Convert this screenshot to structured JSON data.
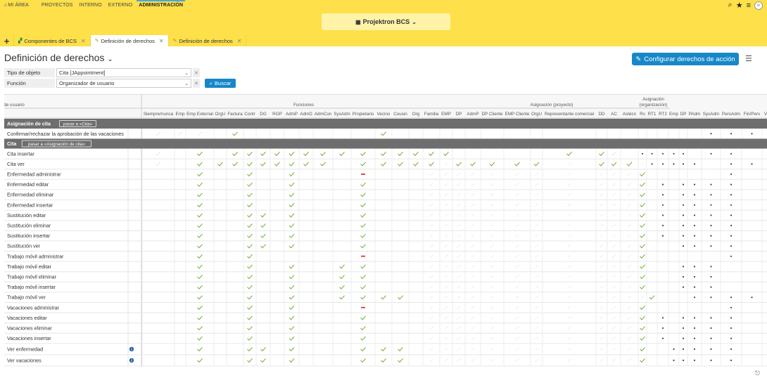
{
  "nav": {
    "items": [
      {
        "label": "MI ÁREA",
        "active": false
      },
      {
        "label": "PROYECTOS",
        "active": false
      },
      {
        "label": "INTERNO",
        "active": false
      },
      {
        "label": "EXTERNO",
        "active": false
      },
      {
        "label": "ADMINISTRACIÓN",
        "active": true
      }
    ]
  },
  "project": {
    "label": "Projektron BCS"
  },
  "tabs": [
    {
      "label": "Componentes de BCS",
      "active": false
    },
    {
      "label": "Definición de derechos",
      "active": true
    },
    {
      "label": "Definición de derechos",
      "active": false
    }
  ],
  "page": {
    "title": "Definición de derechos",
    "config_button": "Configurar derechos de acción"
  },
  "filters": {
    "tipo_label": "Tipo de objeto",
    "tipo_value": "Cita [JAppointment]",
    "funcion_label": "Función",
    "funcion_value": "Organizador de usuario",
    "search_button": "Buscar"
  },
  "colors": {
    "accent": "#1787c8",
    "topbar": "#fde04a",
    "check": "#7fb24b",
    "forbidden": "#d9363e",
    "section": "#6e6e6e"
  },
  "table": {
    "groups": [
      {
        "label": "Funciones",
        "start": 1,
        "end": 19
      },
      {
        "label": "Asignación (proyecto)",
        "start": 20,
        "end": 27
      },
      {
        "label": "Asignación (organización)",
        "start": 28,
        "end": 30
      },
      {
        "label": "Licencias de usuario",
        "start": 31,
        "end": 43
      }
    ],
    "columns": [
      "Siempre/nunca",
      "Emp",
      "Emp External",
      "OrgU",
      "Factura",
      "Contr",
      "DG",
      "RGP",
      "AdmP",
      "AdmD",
      "AdmCon",
      "SysAdm",
      "Propietario",
      "Vecino",
      "Cousin",
      "Org",
      "Familia",
      "EMP",
      "DP",
      "AdmP",
      "DP Cliente",
      "EMP Cliente",
      "OrgU",
      "Representante comercial",
      "DD",
      "AC",
      "Astécn",
      "Rs",
      "RT1",
      "RT2",
      "Emp",
      "DP",
      "PAdm",
      "SysAdm",
      "PersAdm",
      "Fin/Pers",
      "Ventas"
    ],
    "rows": [
      {
        "kind": "section",
        "label": "Asignación de cita",
        "link": "pasar a «Cita»"
      },
      {
        "label": "Confirmar/rechazar la aprobación de las vacaciones",
        "info": false,
        "cells": "xxx.c........c...................ddddd.d."
      },
      {
        "kind": "section",
        "label": "Cita",
        "link": "pasar a «Asignación de cita»"
      },
      {
        "label": "Cita insertar",
        "info": false,
        "cells": "x.c.cccccccccccccc.....ccx.ddddd.dd"
      },
      {
        "label": "Cita ver",
        "info": false,
        "cells": "x.ccccccccc.ccccc.ccccc.ccc.ddddd.ddd"
      },
      {
        "label": "Enfermedad administrar",
        "info": false,
        "cells": "..c..c..c...f..............c......d.d"
      },
      {
        "label": "Enfermedad editar",
        "info": false,
        "cells": "..c..c..c...c..............c.d.dddd.dd"
      },
      {
        "label": "Enfermedad eliminar",
        "info": false,
        "cells": "..c..c..c...c..............c.d.dddd.dd"
      },
      {
        "label": "Enfermedad insertar",
        "info": false,
        "cells": "..c..c..c...c..............c.d.dddd.dd"
      },
      {
        "label": "Sustitución editar",
        "info": false,
        "cells": "..c..cc.c...c..............c.d.dddd.d"
      },
      {
        "label": "Sustitución eliminar",
        "info": false,
        "cells": "..c..cc.c...c..............c.d.dddd.d"
      },
      {
        "label": "Sustitución insertar",
        "info": false,
        "cells": "..c..cc.c...c..............c.d.dddd.d"
      },
      {
        "label": "Sustitución ver",
        "info": false,
        "cells": "..c..cc.c...c..............c...dddd.dd"
      },
      {
        "label": "Trabajo móvil administrar",
        "info": false,
        "cells": "..c..c......f..............c......d.d"
      },
      {
        "label": "Trabajo móvil editar",
        "info": false,
        "cells": "..c..c..c..cc..............c...ddd..dd"
      },
      {
        "label": "Trabajo móvil eliminar",
        "info": false,
        "cells": "..c..c..c..cc..............c...ddd..dd"
      },
      {
        "label": "Trabajo móvil insertar",
        "info": false,
        "cells": "..c..c..c..cc..............c...ddd..dd"
      },
      {
        "label": "Trabajo móvil ver",
        "info": false,
        "cells": "..c..c..c..cccc.............c...dddd.dd"
      },
      {
        "label": "Vacaciones administrar",
        "info": false,
        "cells": "..c..c..c...f..............c......d.d"
      },
      {
        "label": "Vacaciones editar",
        "info": false,
        "cells": "..c..c..c...c..............c.d.dddd.dd"
      },
      {
        "label": "Vacaciones eliminar",
        "info": false,
        "cells": "..c..c..c...c..............c.d.dddd.dd"
      },
      {
        "label": "Vacaciones insertar",
        "info": false,
        "cells": "..c..c..c...c..............c.d.dddd.dd"
      },
      {
        "label": "Ver enfermedad",
        "info": true,
        "cells": "..c..cc.c...ccc............c..ddddd.dd"
      },
      {
        "label": "Ver vacaciones",
        "info": true,
        "cells": "..c..cc.c...ccc............c..ddddd.dd"
      }
    ]
  }
}
